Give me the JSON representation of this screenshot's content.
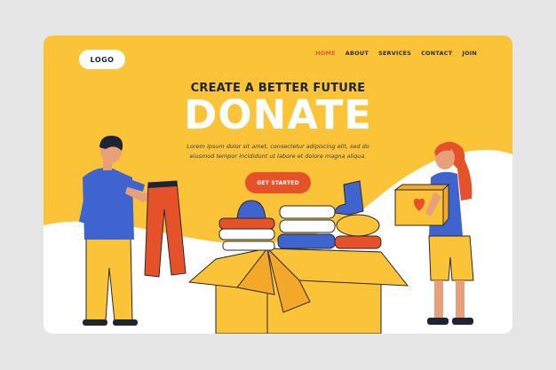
{
  "header": {
    "logo_label": "LOGO",
    "nav": [
      {
        "label": "HOME"
      },
      {
        "label": "ABOUT"
      },
      {
        "label": "SERVICES"
      },
      {
        "label": "CONTACT"
      },
      {
        "label": "JOIN"
      }
    ],
    "active_nav": "HOME"
  },
  "hero": {
    "headline": "CREATE A BETTER FUTURE",
    "title": "DONATE",
    "body_line1": "Lorem ipsum dolor sit amet, consectetur adipiscing elit, sed do",
    "body_line2": "eiusmod tempor incididunt ut labore et dolore magna aliqua.",
    "cta_label": "GET STARTED"
  },
  "colors": {
    "page_background": "#e6e6e6",
    "card_yellow": "#fbc338",
    "white": "#ffffff",
    "accent_orange": "#e5522a",
    "text_dark": "#1d2433",
    "shirt_blue": "#3f63cf"
  },
  "icons": [
    "man-figure-holding-pants",
    "open-donation-box",
    "folded-clothes-pile",
    "woman-figure-holding-box",
    "heart-icon"
  ]
}
